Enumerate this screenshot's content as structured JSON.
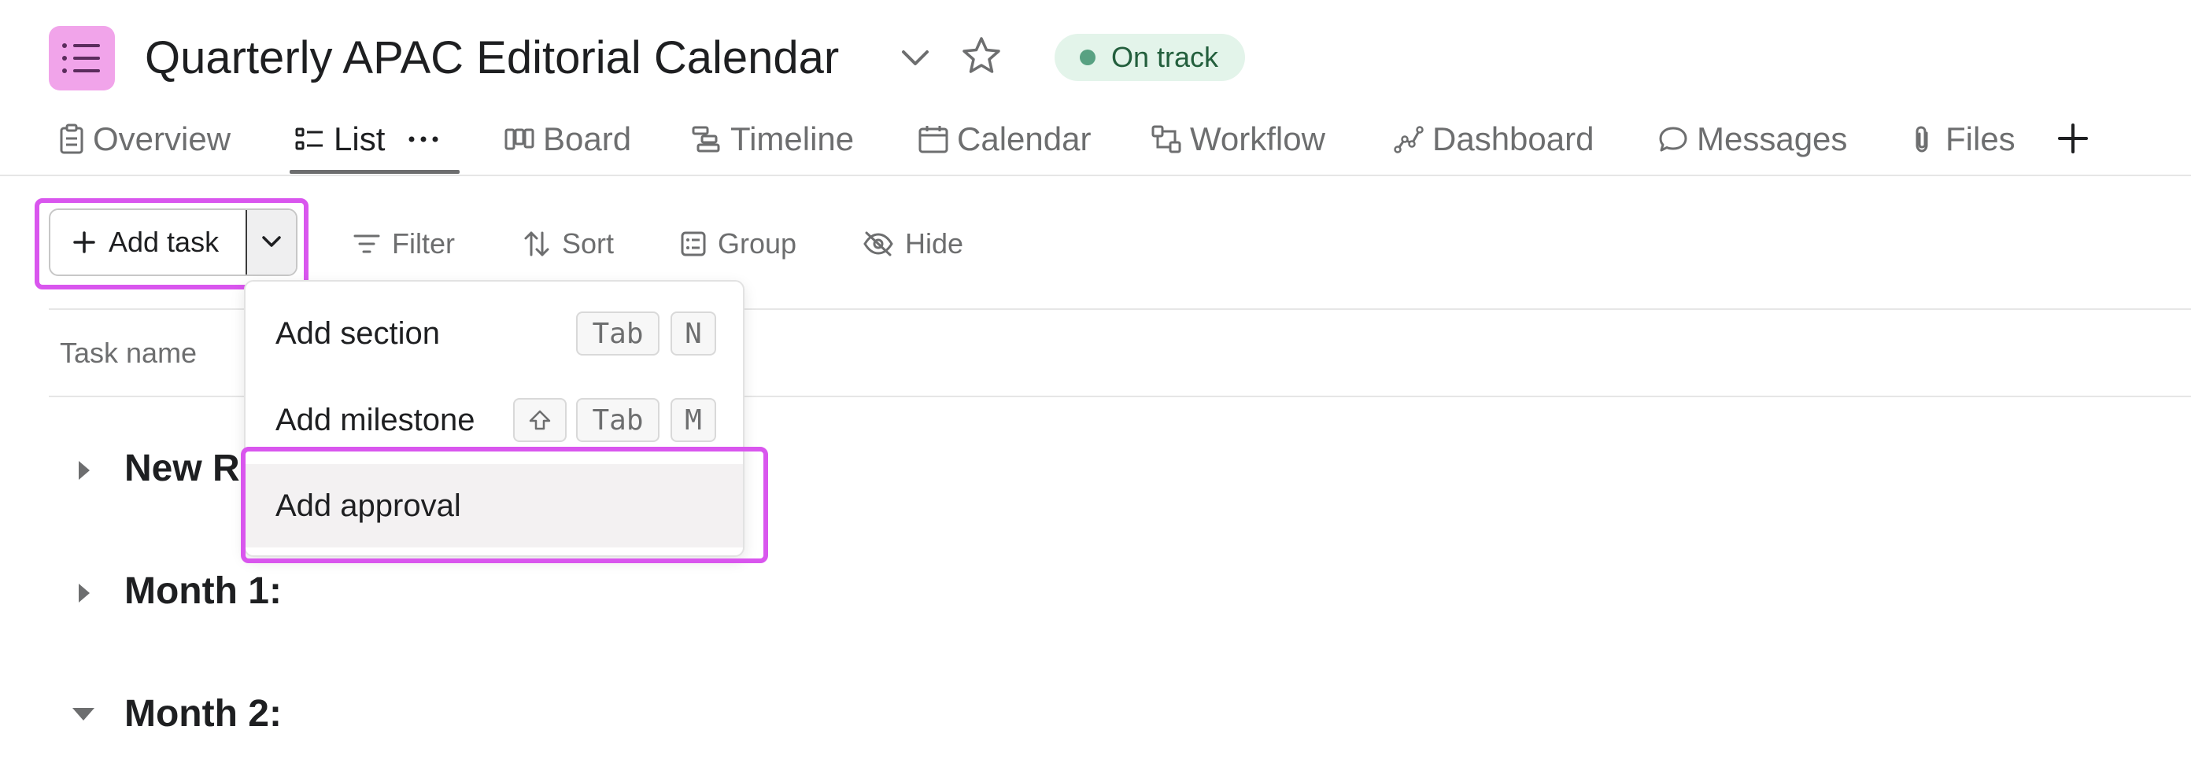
{
  "project": {
    "title": "Quarterly APAC Editorial Calendar",
    "status": "On track",
    "icon": "list-icon",
    "colors": {
      "icon_bg": "#f1a4ea",
      "status_bg": "#e3f4ea",
      "status_text": "#235f3d",
      "status_dot": "#58a182"
    }
  },
  "tabs": [
    {
      "label": "Overview",
      "icon": "clipboard-icon"
    },
    {
      "label": "List",
      "icon": "list-icon",
      "active": true
    },
    {
      "label": "Board",
      "icon": "board-icon"
    },
    {
      "label": "Timeline",
      "icon": "timeline-icon"
    },
    {
      "label": "Calendar",
      "icon": "calendar-icon"
    },
    {
      "label": "Workflow",
      "icon": "workflow-icon"
    },
    {
      "label": "Dashboard",
      "icon": "dashboard-icon"
    },
    {
      "label": "Messages",
      "icon": "message-icon"
    },
    {
      "label": "Files",
      "icon": "paperclip-icon"
    }
  ],
  "toolbar": {
    "add_task": "Add task",
    "filter": "Filter",
    "sort": "Sort",
    "group": "Group",
    "hide": "Hide"
  },
  "list": {
    "column_task_name": "Task name",
    "sections": [
      {
        "label": "New R",
        "expanded": false
      },
      {
        "label": "Month 1:",
        "expanded": false
      },
      {
        "label": "Month 2:",
        "expanded": true
      }
    ]
  },
  "menu": {
    "items": [
      {
        "label": "Add section",
        "shortcut": [
          "Tab",
          "N"
        ]
      },
      {
        "label": "Add milestone",
        "shortcut": [
          "⇧",
          "Tab",
          "M"
        ]
      },
      {
        "label": "Add approval",
        "shortcut": []
      }
    ],
    "hovered_item": "Add approval"
  },
  "highlight_color": "#d956ee"
}
